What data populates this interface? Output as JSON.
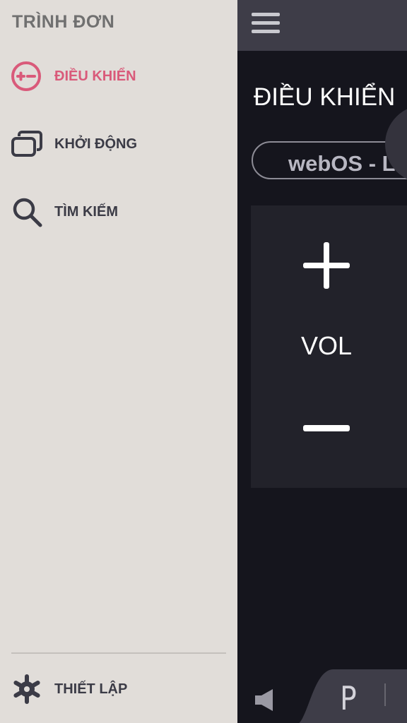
{
  "drawer": {
    "title": "TRÌNH ĐƠN",
    "items": [
      {
        "label": "ĐIỀU KHIỂN",
        "icon": "remote-control-icon",
        "active": true
      },
      {
        "label": "KHỞI ĐỘNG",
        "icon": "launch-windows-icon",
        "active": false
      },
      {
        "label": "TÌM KIẾM",
        "icon": "search-icon",
        "active": false
      }
    ],
    "settings_label": "THIẾT LẬP",
    "accent_color": "#d95a7a"
  },
  "main": {
    "title": "ĐIỀU KHIỂN",
    "device_name": "webOS - Li",
    "volume": {
      "label": "VOL",
      "plus_icon": "plus-icon",
      "minus_icon": "minus-icon"
    },
    "bottom": {
      "speaker_icon": "speaker-icon",
      "tab_glyph": "P"
    }
  }
}
